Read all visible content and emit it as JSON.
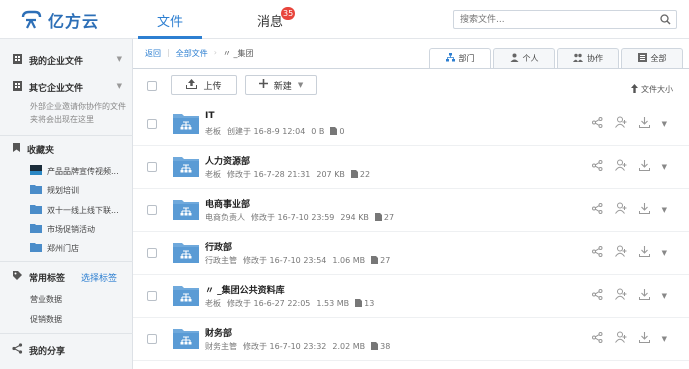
{
  "brand": {
    "logo_text": "亿方云",
    "accent": "#2d7fd1"
  },
  "nav": {
    "files_label": "文件",
    "messages_label": "消息",
    "messages_badge": "35"
  },
  "search": {
    "placeholder": "搜索文件..."
  },
  "sidebar": {
    "my_enterprise_files": "我的企业文件",
    "other_enterprise_files": "其它企业文件",
    "note_line1": "外部企业邀请你协作的文件",
    "note_line2": "夹将会出现在这里",
    "favorites_label": "收藏夹",
    "favorites": [
      {
        "label": "产品品牌宣传视频...",
        "icon": "video-thumbnail-icon"
      },
      {
        "label": "规划培训",
        "icon": "folder-icon"
      },
      {
        "label": "双十一线上线下联...",
        "icon": "folder-icon"
      },
      {
        "label": "市场促销活动",
        "icon": "folder-icon"
      },
      {
        "label": "郑州门店",
        "icon": "folder-icon"
      }
    ],
    "tags_label": "常用标签",
    "choose_tags": "选择标签",
    "tags": [
      "营业数据",
      "促销数据"
    ],
    "my_share": "我的分享"
  },
  "breadcrumb": {
    "back": "返回",
    "all_files": "全部文件",
    "separator": "›",
    "current": "〃 _集团"
  },
  "filter_tabs": [
    {
      "label": "部门",
      "icon": "org-chart-icon",
      "active": true
    },
    {
      "label": "个人",
      "icon": "person-icon",
      "active": false
    },
    {
      "label": "协作",
      "icon": "group-icon",
      "active": false
    },
    {
      "label": "全部",
      "icon": "list-icon",
      "active": false
    }
  ],
  "toolbar": {
    "upload_label": "上传",
    "new_label": "新建",
    "sort_label": "文件大小"
  },
  "files": [
    {
      "name": "IT",
      "owner": "老板",
      "action": "创建于",
      "date": "16-8-9 12:04",
      "size": "0 B",
      "count": "0"
    },
    {
      "name": "人力资源部",
      "owner": "老板",
      "action": "修改于",
      "date": "16-7-28 21:31",
      "size": "207 KB",
      "count": "22"
    },
    {
      "name": "电商事业部",
      "owner": "电商负责人",
      "action": "修改于",
      "date": "16-7-10 23:59",
      "size": "294 KB",
      "count": "27"
    },
    {
      "name": "行政部",
      "owner": "行政主管",
      "action": "修改于",
      "date": "16-7-10 23:54",
      "size": "1.06 MB",
      "count": "27"
    },
    {
      "name": "〃 _集团公共资料库",
      "owner": "老板",
      "action": "修改于",
      "date": "16-6-27 22:05",
      "size": "1.53 MB",
      "count": "13"
    },
    {
      "name": "财务部",
      "owner": "财务主管",
      "action": "修改于",
      "date": "16-7-10 23:32",
      "size": "2.02 MB",
      "count": "38"
    }
  ]
}
